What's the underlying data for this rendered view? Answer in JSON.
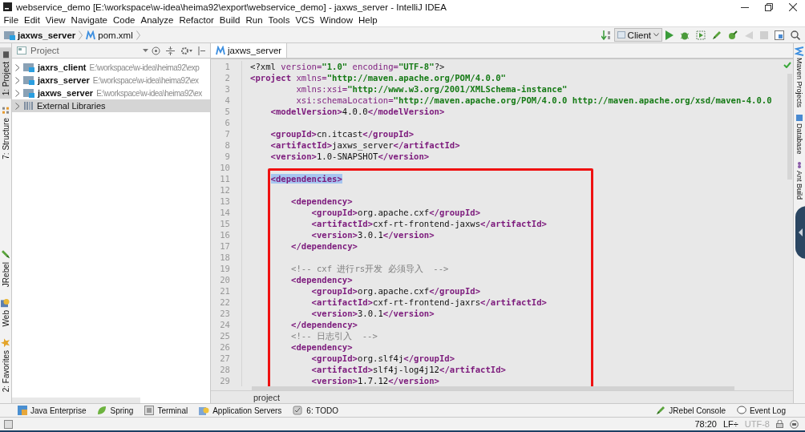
{
  "window": {
    "title": "webservice_demo [E:\\workspace\\w-idea\\heima92\\export\\webservice_demo] - jaxws_server - IntelliJ IDEA"
  },
  "menu": [
    {
      "label": "File"
    },
    {
      "label": "Edit"
    },
    {
      "label": "View"
    },
    {
      "label": "Navigate"
    },
    {
      "label": "Code"
    },
    {
      "label": "Analyze"
    },
    {
      "label": "Refactor"
    },
    {
      "label": "Build"
    },
    {
      "label": "Run"
    },
    {
      "label": "Tools"
    },
    {
      "label": "VCS"
    },
    {
      "label": "Window"
    },
    {
      "label": "Help"
    }
  ],
  "navbar": {
    "crumbs": [
      {
        "label": "jaxws_server",
        "kind": "module"
      },
      {
        "label": "pom.xml",
        "kind": "maven"
      }
    ],
    "run_config": "Client"
  },
  "left_stripe": {
    "top": [
      {
        "label": "1: Project",
        "kind": "project",
        "selected": true
      },
      {
        "label": "7: Structure",
        "kind": "structure",
        "selected": false
      }
    ],
    "bottom": [
      {
        "label": "JRebel",
        "kind": "jrebel",
        "selected": false
      },
      {
        "label": "Web",
        "kind": "web",
        "selected": false
      },
      {
        "label": "2: Favorites",
        "kind": "favorites",
        "selected": false
      }
    ]
  },
  "project_panel": {
    "title": "Project",
    "items": [
      {
        "name": "jaxrs_client",
        "path": "E:\\workspace\\w-idea\\heima92\\exp",
        "kind": "module",
        "selected": false
      },
      {
        "name": "jaxrs_server",
        "path": "E:\\workspace\\w-idea\\heima92\\ex",
        "kind": "module",
        "selected": false
      },
      {
        "name": "jaxws_server",
        "path": "E:\\workspace\\w-idea\\heima92\\ex",
        "kind": "module",
        "selected": false
      },
      {
        "name": "External Libraries",
        "kind": "library",
        "selected": true
      }
    ]
  },
  "editor": {
    "tabs": [
      {
        "label": "jaxws_server",
        "selected": true
      }
    ],
    "breadcrumb": "project",
    "lines": [
      {
        "number": "1",
        "framed": false,
        "segments": [
          {
            "kind": "plain",
            "text": "<?xml "
          },
          {
            "kind": "attr",
            "text": "version="
          },
          {
            "kind": "value",
            "text": "\"1.0\""
          },
          {
            "kind": "attr",
            "text": " encoding="
          },
          {
            "kind": "value",
            "text": "\"UTF-8\""
          },
          {
            "kind": "plain",
            "text": "?>"
          }
        ]
      },
      {
        "number": "2",
        "framed": false,
        "segments": [
          {
            "kind": "tag",
            "text": "<project "
          },
          {
            "kind": "attr",
            "text": "xmlns="
          },
          {
            "kind": "value",
            "text": "\"http://maven.apache.org/POM/4.0.0\""
          }
        ]
      },
      {
        "number": "3",
        "framed": false,
        "segments": [
          {
            "kind": "attr",
            "text": "         xmlns:xsi="
          },
          {
            "kind": "value",
            "text": "\"http://www.w3.org/2001/XMLSchema-instance\""
          }
        ]
      },
      {
        "number": "4",
        "framed": false,
        "segments": [
          {
            "kind": "attr",
            "text": "         xsi:schemaLocation="
          },
          {
            "kind": "value",
            "text": "\"http://maven.apache.org/POM/4.0.0 http://maven.apache.org/xsd/maven-4.0.0"
          }
        ]
      },
      {
        "number": "5",
        "framed": false,
        "segments": [
          {
            "kind": "tag",
            "text": "    <modelVersion>"
          },
          {
            "kind": "plain",
            "text": "4.0.0"
          },
          {
            "kind": "tag",
            "text": "</modelVersion>"
          }
        ]
      },
      {
        "number": "6",
        "framed": false
      },
      {
        "number": "7",
        "framed": false,
        "segments": [
          {
            "kind": "tag",
            "text": "    <groupId>"
          },
          {
            "kind": "plain",
            "text": "cn.itcast"
          },
          {
            "kind": "tag",
            "text": "</groupId>"
          }
        ]
      },
      {
        "number": "8",
        "framed": false,
        "segments": [
          {
            "kind": "tag",
            "text": "    <artifactId>"
          },
          {
            "kind": "plain",
            "text": "jaxws_server"
          },
          {
            "kind": "tag",
            "text": "</artifactId>"
          }
        ]
      },
      {
        "number": "9",
        "framed": false,
        "segments": [
          {
            "kind": "tag",
            "text": "    <version>"
          },
          {
            "kind": "plain",
            "text": "1.0-SNAPSHOT"
          },
          {
            "kind": "tag",
            "text": "</version>"
          }
        ]
      },
      {
        "number": "10",
        "framed": false
      },
      {
        "number": "11",
        "framed": true,
        "segments": [
          {
            "kind": "tag",
            "text": "    <dependencies>",
            "selected": true
          }
        ]
      },
      {
        "number": "12",
        "framed": true
      },
      {
        "number": "13",
        "framed": true,
        "segments": [
          {
            "kind": "tag",
            "text": "        <dependency>"
          }
        ]
      },
      {
        "number": "14",
        "framed": true,
        "segments": [
          {
            "kind": "tag",
            "text": "            <groupId>"
          },
          {
            "kind": "plain",
            "text": "org.apache.cxf"
          },
          {
            "kind": "tag",
            "text": "</groupId>"
          }
        ]
      },
      {
        "number": "15",
        "framed": true,
        "segments": [
          {
            "kind": "tag",
            "text": "            <artifactId>"
          },
          {
            "kind": "plain",
            "text": "cxf-rt-frontend-jaxws"
          },
          {
            "kind": "tag",
            "text": "</artifactId>"
          }
        ]
      },
      {
        "number": "16",
        "framed": true,
        "segments": [
          {
            "kind": "tag",
            "text": "            <version>"
          },
          {
            "kind": "plain",
            "text": "3.0.1"
          },
          {
            "kind": "tag",
            "text": "</version>"
          }
        ]
      },
      {
        "number": "17",
        "framed": true,
        "segments": [
          {
            "kind": "tag",
            "text": "        </dependency>"
          }
        ]
      },
      {
        "number": "18",
        "framed": true
      },
      {
        "number": "19",
        "framed": true,
        "segments": [
          {
            "kind": "comment",
            "text": "        <!-- cxf 进行rs开发 必须导入  -->"
          }
        ]
      },
      {
        "number": "20",
        "framed": true,
        "segments": [
          {
            "kind": "tag",
            "text": "        <dependency>"
          }
        ]
      },
      {
        "number": "21",
        "framed": true,
        "segments": [
          {
            "kind": "tag",
            "text": "            <groupId>"
          },
          {
            "kind": "plain",
            "text": "org.apache.cxf"
          },
          {
            "kind": "tag",
            "text": "</groupId>"
          }
        ]
      },
      {
        "number": "22",
        "framed": true,
        "segments": [
          {
            "kind": "tag",
            "text": "            <artifactId>"
          },
          {
            "kind": "plain",
            "text": "cxf-rt-frontend-jaxrs"
          },
          {
            "kind": "tag",
            "text": "</artifactId>"
          }
        ]
      },
      {
        "number": "23",
        "framed": true,
        "segments": [
          {
            "kind": "tag",
            "text": "            <version>"
          },
          {
            "kind": "plain",
            "text": "3.0.1"
          },
          {
            "kind": "tag",
            "text": "</version>"
          }
        ]
      },
      {
        "number": "24",
        "framed": true,
        "segments": [
          {
            "kind": "tag",
            "text": "        </dependency>"
          }
        ]
      },
      {
        "number": "25",
        "framed": true,
        "segments": [
          {
            "kind": "comment",
            "text": "        <!-- 日志引入  -->"
          }
        ]
      },
      {
        "number": "26",
        "framed": true,
        "segments": [
          {
            "kind": "tag",
            "text": "        <dependency>"
          }
        ]
      },
      {
        "number": "27",
        "framed": true,
        "segments": [
          {
            "kind": "tag",
            "text": "            <groupId>"
          },
          {
            "kind": "plain",
            "text": "org.slf4j"
          },
          {
            "kind": "tag",
            "text": "</groupId>"
          }
        ]
      },
      {
        "number": "28",
        "framed": true,
        "segments": [
          {
            "kind": "tag",
            "text": "            <artifactId>"
          },
          {
            "kind": "plain",
            "text": "slf4j-log4j12"
          },
          {
            "kind": "tag",
            "text": "</artifactId>"
          }
        ]
      },
      {
        "number": "29",
        "framed": true,
        "segments": [
          {
            "kind": "tag",
            "text": "            <version>"
          },
          {
            "kind": "plain",
            "text": "1.7.12"
          },
          {
            "kind": "tag",
            "text": "</version>"
          }
        ]
      }
    ]
  },
  "right_stripe": [
    {
      "label": "Maven Projects",
      "kind": "maven"
    },
    {
      "label": "Database",
      "kind": "database"
    },
    {
      "label": "Ant Build",
      "kind": "ant"
    }
  ],
  "tool_windows": {
    "left": [
      {
        "label": "Java Enterprise",
        "kind": "javaee"
      },
      {
        "label": "Spring",
        "kind": "spring"
      },
      {
        "label": "Terminal",
        "kind": "terminal"
      },
      {
        "label": "Application Servers",
        "kind": "servers"
      },
      {
        "label": "6: TODO",
        "kind": "todo"
      }
    ],
    "right": [
      {
        "label": "JRebel Console",
        "kind": "jrebel"
      },
      {
        "label": "Event Log",
        "kind": "log"
      }
    ]
  },
  "status": {
    "position": "78:20",
    "line_separator": "LF÷",
    "encoding": "UTF-8"
  }
}
